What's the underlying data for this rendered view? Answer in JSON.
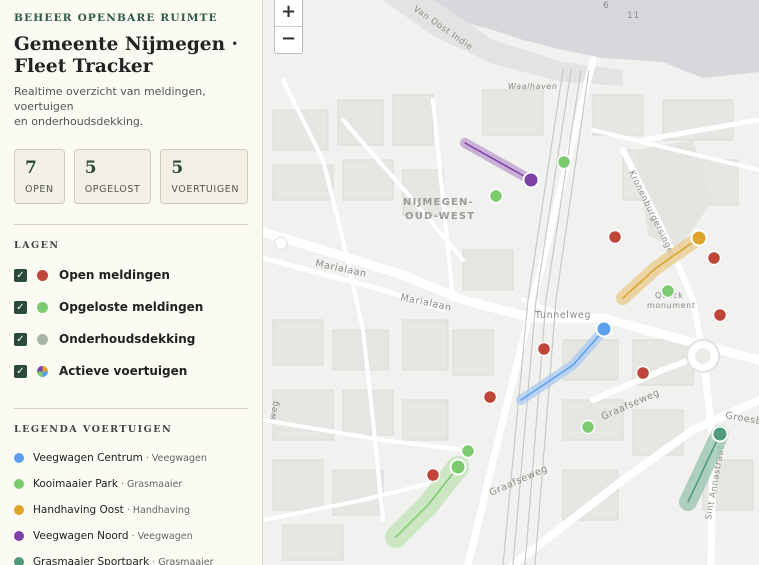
{
  "header": {
    "eyebrow": "BEHEER OPENBARE RUIMTE",
    "title_line1": "Gemeente Nijmegen ·",
    "title_line2": "Fleet Tracker",
    "subtitle_line1": "Realtime overzicht van meldingen, voertuigen",
    "subtitle_line2": "en onderhoudsdekking."
  },
  "stats": [
    {
      "value": "7",
      "label": "OPEN"
    },
    {
      "value": "5",
      "label": "OPGELOST"
    },
    {
      "value": "5",
      "label": "VOERTUIGEN"
    }
  ],
  "layers": {
    "heading": "LAGEN",
    "items": [
      {
        "label": "Open meldingen",
        "checked": true,
        "color": "#c0463a"
      },
      {
        "label": "Opgeloste meldingen",
        "checked": true,
        "color": "#7ccb6f"
      },
      {
        "label": "Onderhoudsdekking",
        "checked": true,
        "color": "#a9b5a4"
      },
      {
        "label": "Actieve voertuigen",
        "checked": true,
        "color": "#d9a32c"
      }
    ]
  },
  "legend": {
    "heading": "LEGENDA VOERTUIGEN",
    "items": [
      {
        "name": "Veegwagen Centrum",
        "type": "Veegwagen",
        "color": "#5b9ff0"
      },
      {
        "name": "Kooimaaier Park",
        "type": "Grasmaaier",
        "color": "#7ccb6f"
      },
      {
        "name": "Handhaving Oost",
        "type": "Handhaving",
        "color": "#e0a42c"
      },
      {
        "name": "Veegwagen Noord",
        "type": "Veegwagen",
        "color": "#7e3fa6"
      },
      {
        "name": "Grasmaaier Sportpark",
        "type": "Grasmaaier",
        "color": "#4f9a7b"
      }
    ]
  },
  "map": {
    "zoom_in": "+",
    "zoom_out": "−",
    "labels": {
      "district1": "NIJMEGEN-",
      "district2": "OUD-WEST",
      "marialaan1": "Marialaan",
      "marialaan2": "Marialaan",
      "tunnelweg": "Tunnelweg",
      "graafseweg1": "Graafseweg",
      "graafseweg2": "Graafseweg",
      "waalhaven": "Waalhaven",
      "kronenburger": "Kronenburgersingel",
      "monument1": "Quack",
      "monument2": "monument",
      "sintannastraat": "Sint Annastraat",
      "groesb": "Groesb",
      "vanoost": "Van Oost Indie",
      "weg": "weg",
      "n1": "6",
      "n2": "11"
    },
    "open_color": "#c0463a",
    "resolved_color": "#7ccb6f"
  }
}
